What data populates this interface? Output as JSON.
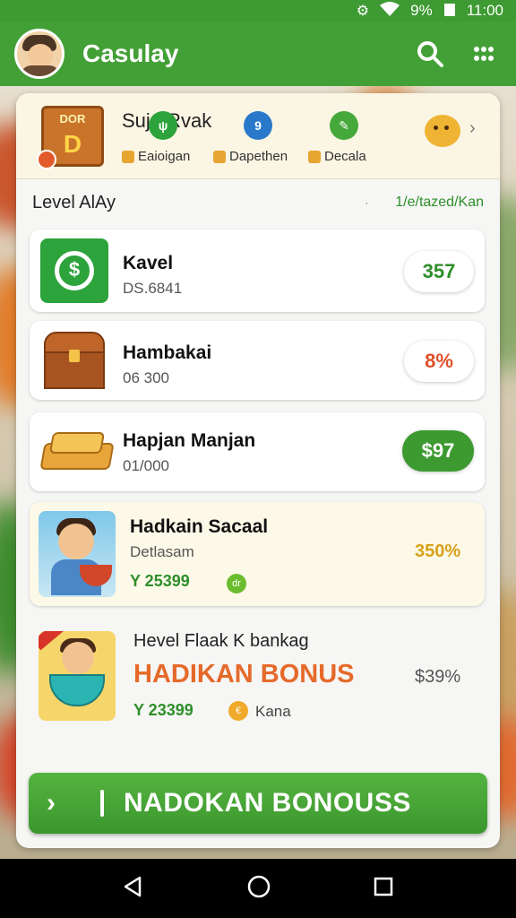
{
  "status_bar": {
    "signal_icon": "signal-icon",
    "wifi_icon": "wifi-icon",
    "battery_text": "9%",
    "time": "11:00"
  },
  "app_bar": {
    "title": "Casulay",
    "search_icon": "search-icon",
    "menu_icon": "grid-menu-icon"
  },
  "header": {
    "logo_top": "DOR",
    "logo_big": "D",
    "name": "Sujn Rvak",
    "badge1": "ψ",
    "badge2": "9",
    "stats": [
      {
        "label": "Eaioigan"
      },
      {
        "label": "Dapethen"
      },
      {
        "label": "Decala"
      }
    ]
  },
  "level": {
    "title": "Level AlAy",
    "dot": "·",
    "link": "1/e/tazed/Kan"
  },
  "items": [
    {
      "name": "Kavel",
      "sub": "DS.6841",
      "value": "357",
      "value_color": "#2e8f2a",
      "pill_style": "white"
    },
    {
      "name": "Hambakai",
      "sub": "06 300",
      "value": "8%",
      "value_color": "#e0502a",
      "pill_style": "white"
    },
    {
      "name": "Hapjan Manjan",
      "sub": "01/000",
      "value": "$97",
      "value_color": "#ffffff",
      "pill_style": "green"
    },
    {
      "name": "Hadkain Sacaal",
      "sub": "Detlasam",
      "reward": "Y 25399",
      "reward_icon": "dr",
      "value": "350%"
    },
    {
      "title": "Hevel Flaak K bankag",
      "headline": "HADIKAN BONUS",
      "reward": "Y 23399",
      "reward_extra": "Kana",
      "value": "$39%"
    }
  ],
  "cta": {
    "label": "NADOKAN BONOUSS"
  },
  "navbar": {
    "back_icon": "back-triangle-icon",
    "home_icon": "home-circle-icon",
    "recents_icon": "recents-square-icon"
  }
}
